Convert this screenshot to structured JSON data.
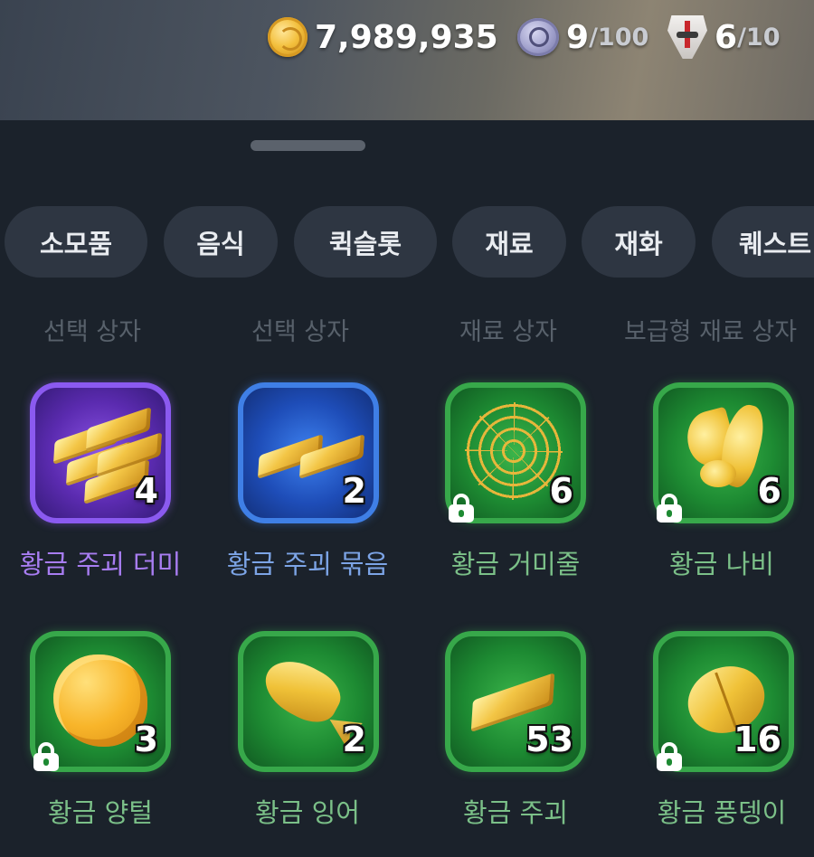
{
  "currencies": {
    "gold": {
      "icon": "gold-coin-icon",
      "value": "7,989,935"
    },
    "silver": {
      "icon": "silver-token-icon",
      "value": "9",
      "max": "/100"
    },
    "mask": {
      "icon": "mask-icon",
      "value": "6",
      "max": "/10"
    }
  },
  "tabs": [
    {
      "label": "소모품"
    },
    {
      "label": "음식"
    },
    {
      "label": "퀵슬롯"
    },
    {
      "label": "재료"
    },
    {
      "label": "재화"
    },
    {
      "label": "퀘스트"
    }
  ],
  "categories": [
    "선택 상자",
    "선택 상자",
    "재료 상자",
    "보급형 재료 상자"
  ],
  "items": [
    {
      "name": "황금 주괴 더미",
      "count": "4",
      "rarity": "purple",
      "locked": false,
      "icon": "gold-bar-pile-icon"
    },
    {
      "name": "황금 주괴 묶음",
      "count": "2",
      "rarity": "blue",
      "locked": false,
      "icon": "gold-bar-bundle-icon"
    },
    {
      "name": "황금 거미줄",
      "count": "6",
      "rarity": "green",
      "locked": true,
      "icon": "golden-web-icon"
    },
    {
      "name": "황금 나비",
      "count": "6",
      "rarity": "green",
      "locked": true,
      "icon": "golden-butterfly-icon"
    },
    {
      "name": "황금 양털",
      "count": "3",
      "rarity": "green",
      "locked": true,
      "icon": "golden-wool-icon"
    },
    {
      "name": "황금 잉어",
      "count": "2",
      "rarity": "green",
      "locked": false,
      "icon": "golden-carp-icon"
    },
    {
      "name": "황금 주괴",
      "count": "53",
      "rarity": "green",
      "locked": false,
      "icon": "gold-bar-icon"
    },
    {
      "name": "황금 풍뎅이",
      "count": "16",
      "rarity": "green",
      "locked": true,
      "icon": "golden-beetle-icon"
    }
  ],
  "colors": {
    "purple": "#8b5af0",
    "blue": "#3f7fe6",
    "green": "#37a84a",
    "background": "#1b222b"
  }
}
